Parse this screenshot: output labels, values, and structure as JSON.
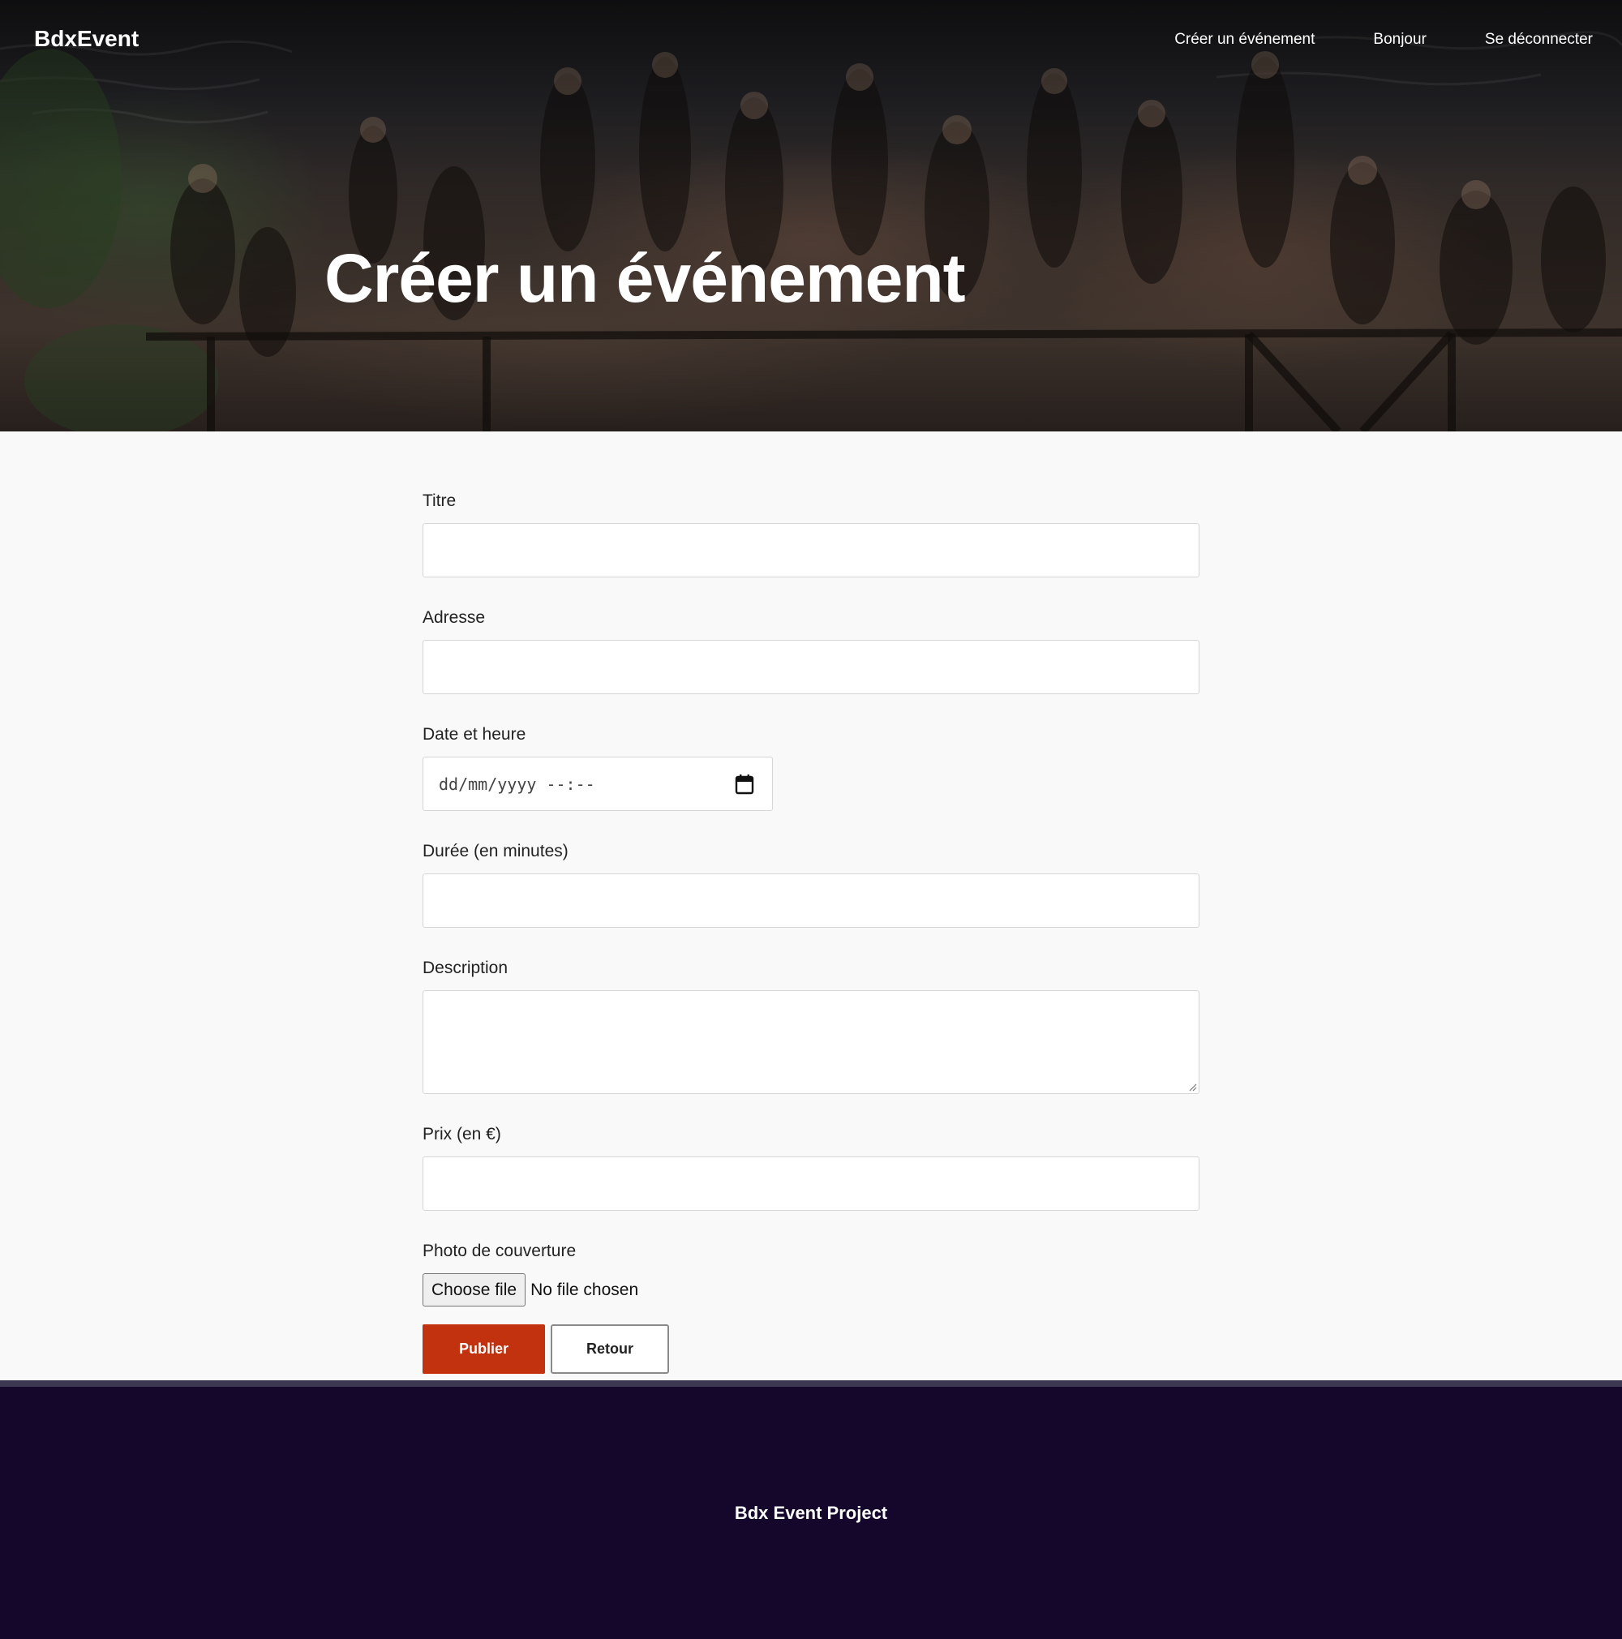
{
  "navbar": {
    "brand": "BdxEvent",
    "links": [
      "Créer un événement",
      "Bonjour",
      "Se déconnecter"
    ]
  },
  "hero": {
    "title": "Créer un événement"
  },
  "form": {
    "title_label": "Titre",
    "address_label": "Adresse",
    "datetime_label": "Date et heure",
    "datetime_placeholder": "dd/mm/yyyy --:--",
    "duration_label": "Durée (en minutes)",
    "description_label": "Description",
    "price_label": "Prix (en €)",
    "photo_label": "Photo de couverture",
    "file_button_label": "Choose file",
    "file_status": "No file chosen",
    "publish_label": "Publier",
    "back_label": "Retour"
  },
  "footer": {
    "text": "Bdx Event Project"
  },
  "colors": {
    "primary_button": "#c3320f",
    "footer_bg": "#14072b"
  }
}
